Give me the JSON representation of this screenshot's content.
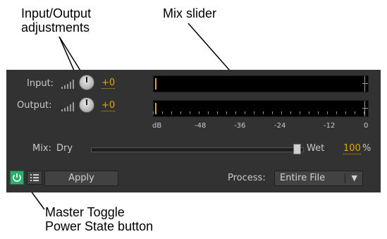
{
  "callouts": {
    "io": "Input/Output\nadjustments",
    "mix": "Mix slider",
    "master": "Master Toggle\nPower State button"
  },
  "panel": {
    "input_label": "Input:",
    "input_value": "+0",
    "output_label": "Output:",
    "output_value": "+0",
    "scale": [
      "dB",
      "-48",
      "-36",
      "-24",
      "-12",
      "0"
    ],
    "mix_label": "Mix:",
    "dry_label": "Dry",
    "wet_label": "Wet",
    "wet_value": "100",
    "percent": "%",
    "mix_level": 1.0,
    "apply_label": "Apply",
    "process_label": "Process:",
    "process_value": "Entire File"
  },
  "colors": {
    "panel_bg": "#323232",
    "accent": "#e1a800",
    "power_on": "#2fae6b"
  }
}
